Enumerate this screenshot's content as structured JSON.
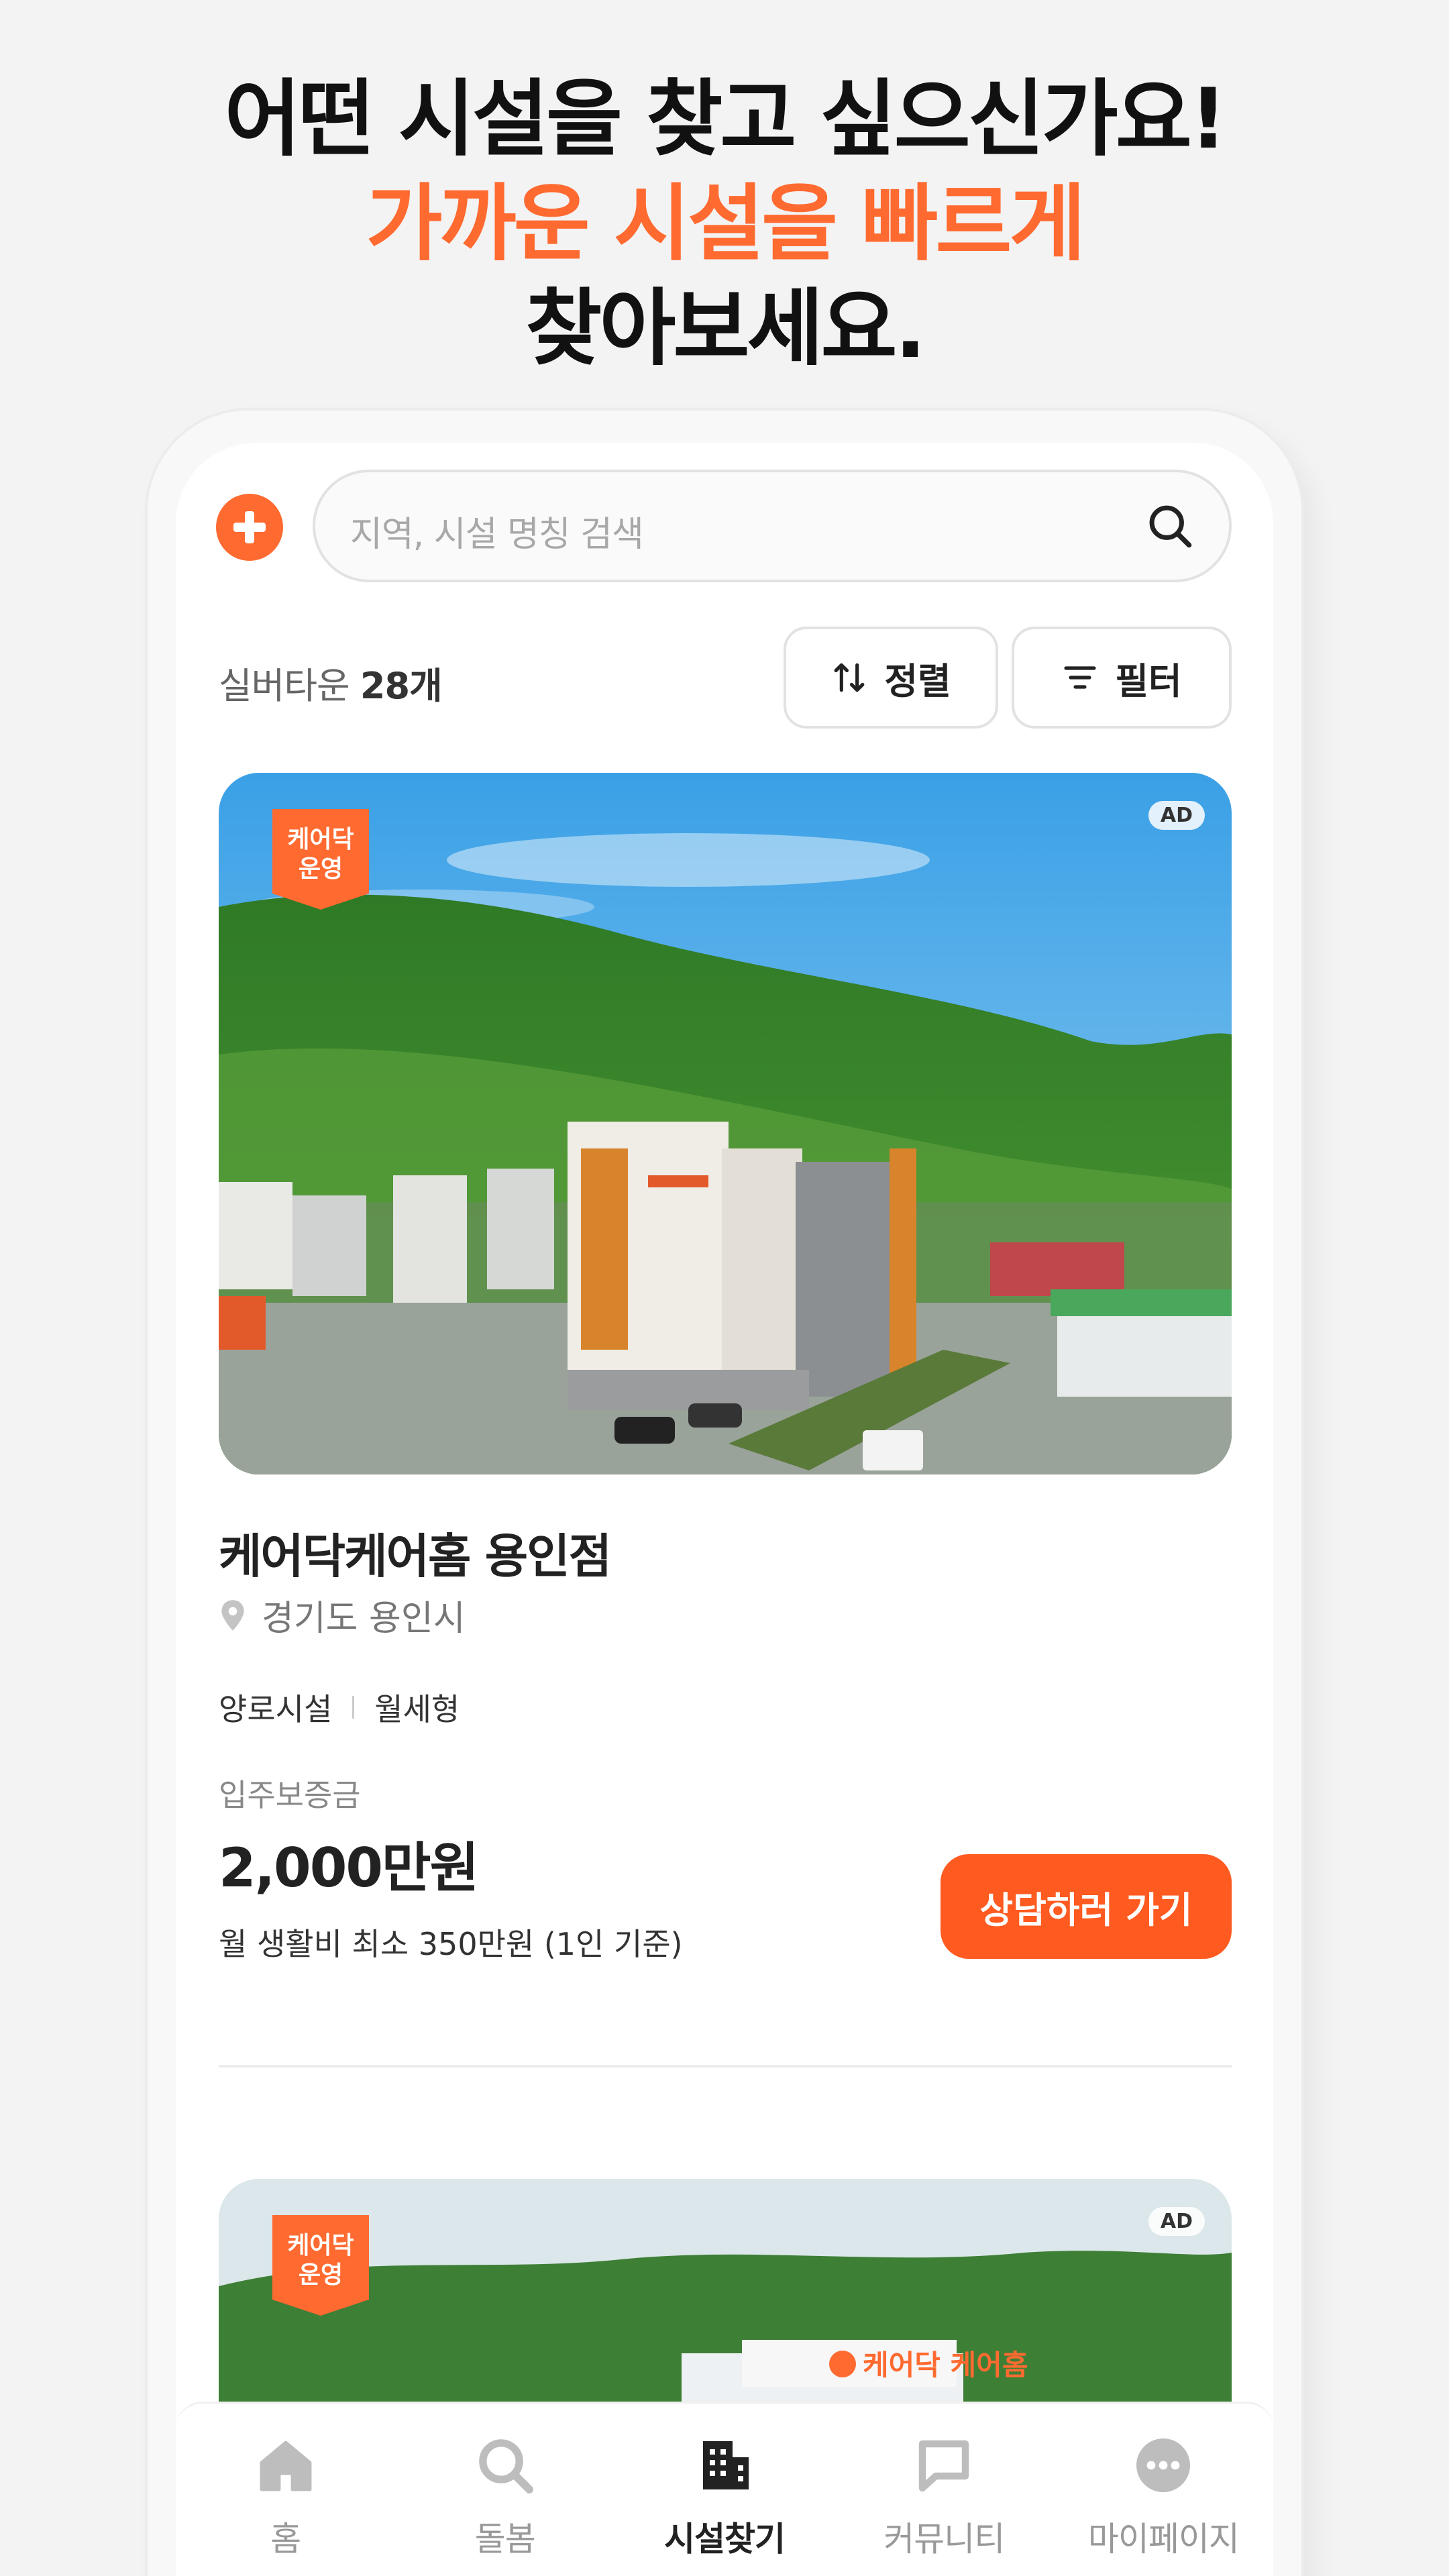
{
  "headline": {
    "line1": "어떤 시설을 찾고 싶으신가요!",
    "line2": "가까운 시설을 빠르게",
    "line3": "찾아보세요."
  },
  "search": {
    "placeholder": "지역, 시설 명칭 검색",
    "icon": "search-icon"
  },
  "list_header": {
    "category": "실버타운",
    "count": "28개",
    "sort_label": "정렬",
    "filter_label": "필터"
  },
  "listings": [
    {
      "badge_line1": "케어닥",
      "badge_line2": "운영",
      "ad_label": "AD",
      "name": "케어닥케어홈 용인점",
      "location": "경기도 용인시",
      "tags": [
        "양로시설",
        "월세형"
      ],
      "deposit_label": "입주보증금",
      "deposit": "2,000만원",
      "monthly": "월 생활비 최소 350만원 (1인 기준)",
      "cta": "상담하러 가기"
    },
    {
      "badge_line1": "케어닥",
      "badge_line2": "운영",
      "ad_label": "AD",
      "sign_text": "케어닥 케어홈"
    }
  ],
  "tabbar": [
    {
      "label": "홈",
      "icon": "home-icon",
      "active": false
    },
    {
      "label": "돌봄",
      "icon": "search-icon",
      "active": false
    },
    {
      "label": "시설찾기",
      "icon": "building-icon",
      "active": true
    },
    {
      "label": "커뮤니티",
      "icon": "chat-icon",
      "active": false
    },
    {
      "label": "마이페이지",
      "icon": "more-icon",
      "active": false
    }
  ],
  "colors": {
    "accent": "#ff6a30",
    "cta": "#ff5a1f",
    "inactive": "#999999"
  }
}
